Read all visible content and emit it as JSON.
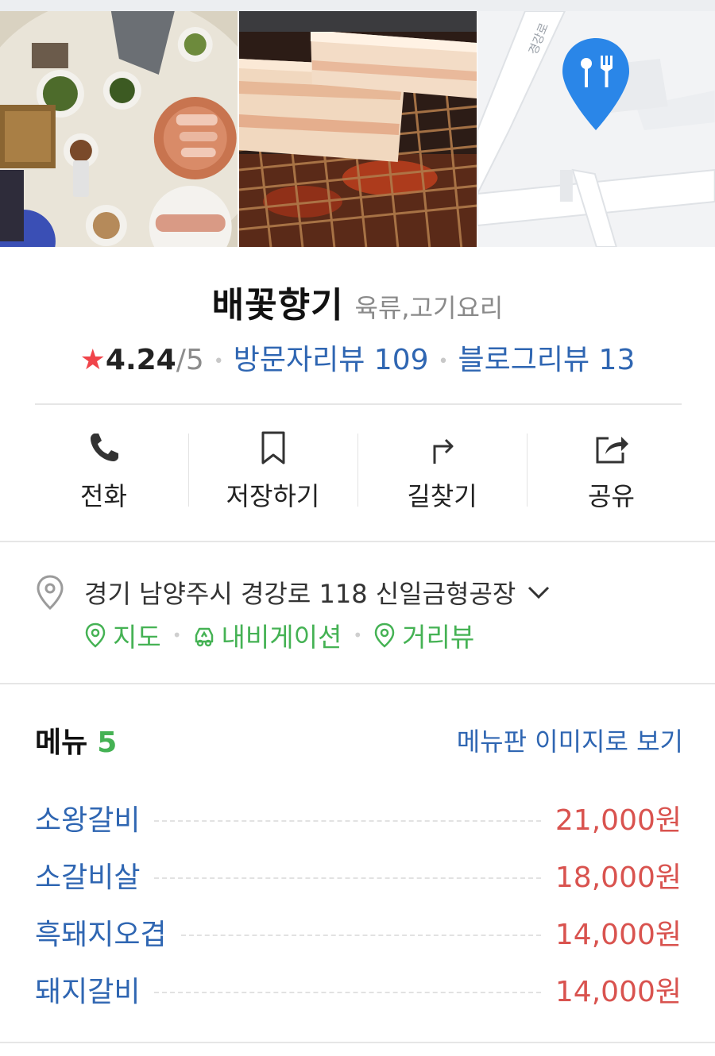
{
  "photos": [
    {
      "description": "food-table-photo"
    },
    {
      "description": "grill-pork-photo"
    },
    {
      "description": "map-preview"
    }
  ],
  "map": {
    "road_label": "경강로"
  },
  "place": {
    "name": "배꽃향기",
    "category": "육류,고기요리",
    "rating": "4.24",
    "rating_max": "/5",
    "visitor_reviews": "방문자리뷰 109",
    "blog_reviews": "블로그리뷰 13"
  },
  "actions": [
    {
      "label": "전화",
      "icon": "phone-icon"
    },
    {
      "label": "저장하기",
      "icon": "bookmark-icon"
    },
    {
      "label": "길찾기",
      "icon": "directions-icon"
    },
    {
      "label": "공유",
      "icon": "share-icon"
    }
  ],
  "address": {
    "text": "경기 남양주시 경강로 118 신일금형공장",
    "links": [
      {
        "label": "지도",
        "icon": "map-pin-icon"
      },
      {
        "label": "내비게이션",
        "icon": "car-icon"
      },
      {
        "label": "거리뷰",
        "icon": "street-view-icon"
      }
    ]
  },
  "menu": {
    "title": "메뉴",
    "count": "5",
    "board_link": "메뉴판 이미지로 보기",
    "items": [
      {
        "name": "소왕갈비",
        "price": "21,000원"
      },
      {
        "name": "소갈비살",
        "price": "18,000원"
      },
      {
        "name": "흑돼지오겹",
        "price": "14,000원"
      },
      {
        "name": "돼지갈비",
        "price": "14,000원"
      }
    ]
  },
  "colors": {
    "link_blue": "#2f66b2",
    "green": "#45b254",
    "price_red": "#d9534f",
    "star_red": "#f0444a",
    "pin_blue": "#2a86e8"
  }
}
